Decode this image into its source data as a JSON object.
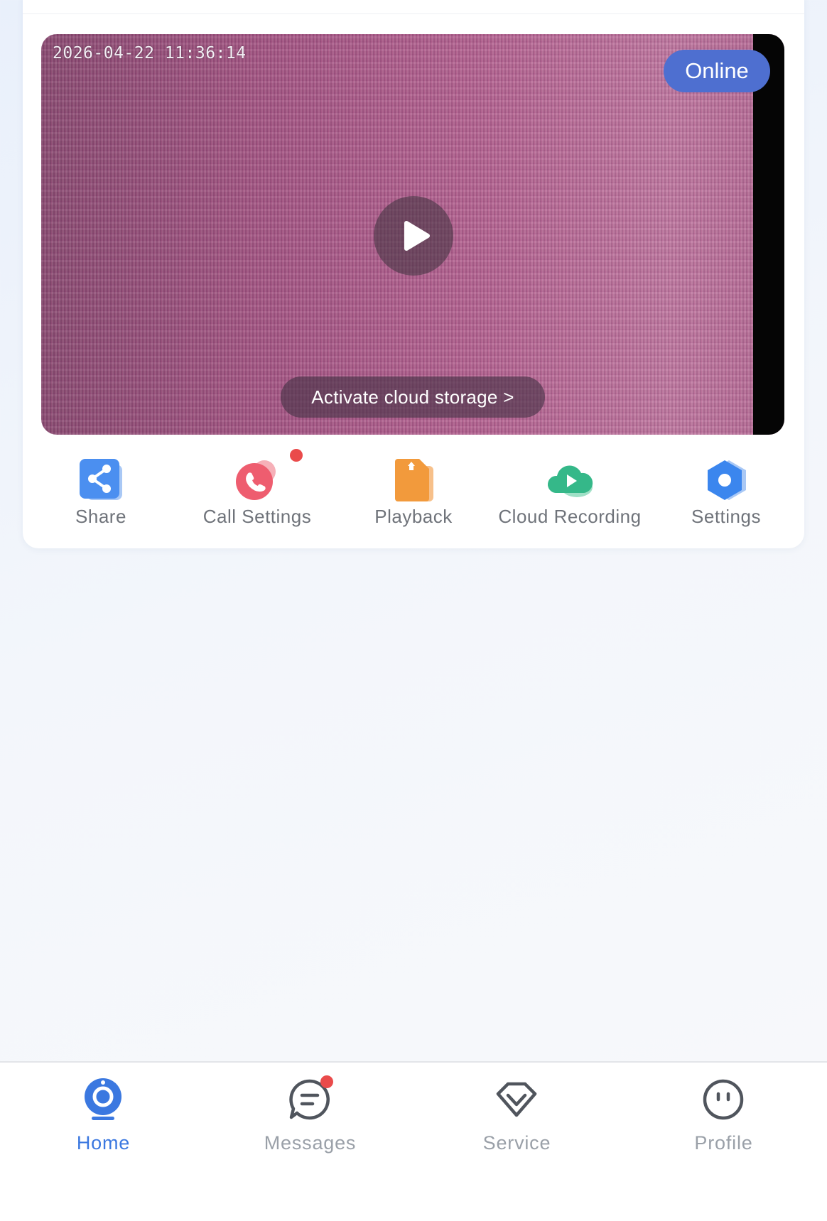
{
  "video": {
    "timestamp": "2026-04-22 11:36:14",
    "status_badge": "Online",
    "cloud_prompt": "Activate cloud storage >"
  },
  "actions": [
    {
      "label": "Share",
      "icon": "share-icon"
    },
    {
      "label": "Call Settings",
      "icon": "phone-icon",
      "badge": true
    },
    {
      "label": "Playback",
      "icon": "sd-card-icon"
    },
    {
      "label": "Cloud Recording",
      "icon": "cloud-play-icon"
    },
    {
      "label": "Settings",
      "icon": "hexagon-gear-icon"
    }
  ],
  "tabbar": {
    "items": [
      {
        "label": "Home",
        "icon": "camera-home-icon",
        "active": true
      },
      {
        "label": "Messages",
        "icon": "chat-icon",
        "badge": true
      },
      {
        "label": "Service",
        "icon": "diamond-icon"
      },
      {
        "label": "Profile",
        "icon": "face-icon"
      }
    ]
  },
  "colors": {
    "accent": "#3b78e0",
    "online_badge": "#4e6fd0",
    "badge_dot": "#ea4b4b",
    "label_gray": "#6f737a"
  }
}
